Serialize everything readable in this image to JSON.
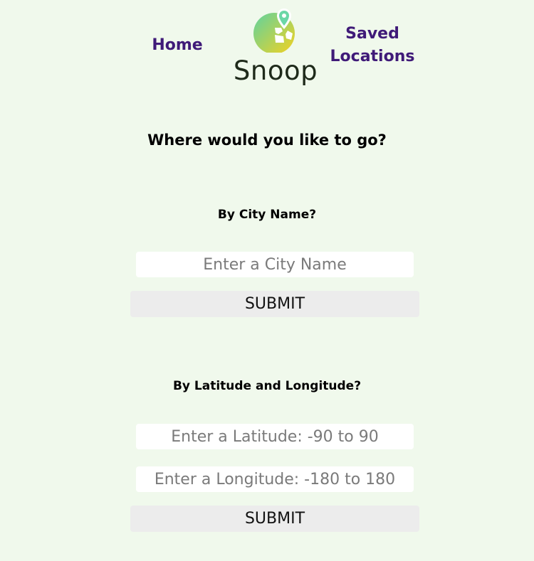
{
  "nav": {
    "home_label": "Home",
    "saved_label": "Saved Locations"
  },
  "logo": {
    "brand": "Snoop",
    "icon": "map-pin-globe-icon",
    "gradient_start": "#5fd3a0",
    "gradient_end": "#f4d11f"
  },
  "main": {
    "headline": "Where would you like to go?"
  },
  "city_search": {
    "title": "By City Name?",
    "input_value": "",
    "input_placeholder": "Enter a City Name",
    "submit_label": "SUBMIT"
  },
  "coord_search": {
    "title": "By Latitude and Longitude?",
    "lat_value": "",
    "lat_placeholder": "Enter a Latitude: -90 to 90",
    "lng_value": "",
    "lng_placeholder": "Enter a Longitude: -180 to 180",
    "submit_label": "SUBMIT"
  },
  "colors": {
    "background": "#f0f9ec",
    "nav_link": "#3f1a78",
    "input_bg": "#ffffff",
    "button_bg": "#ececec"
  }
}
